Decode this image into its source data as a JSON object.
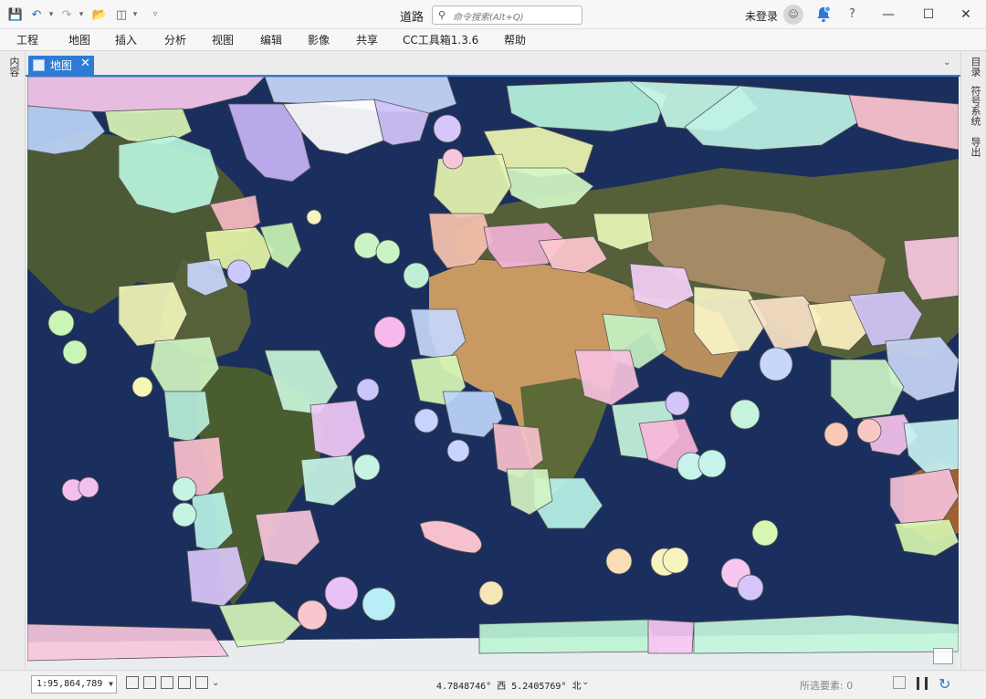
{
  "titlebar": {
    "doc_title": "道路",
    "search_placeholder": "命令搜索(Alt+Q)",
    "login_label": "未登录",
    "help_label": "?"
  },
  "ribbon": {
    "tabs": [
      "工程",
      "地图",
      "插入",
      "分析",
      "视图",
      "编辑",
      "影像",
      "共享",
      "CC工具箱1.3.6",
      "帮助"
    ]
  },
  "left_pane": {
    "tab_label": "内容"
  },
  "right_pane": {
    "tabs": [
      "目录",
      "符号系统",
      "导出"
    ]
  },
  "map_view": {
    "tab_label": "地图",
    "layer": "world marine ecoregions (multicolor polygons) over satellite imagery"
  },
  "statusbar": {
    "scale": "1:95,864,789",
    "coordinates": "4.7848746° 西 5.2405769° 北",
    "selected_features_label": "所选要素:",
    "selected_features_count": "0"
  },
  "colors": {
    "accent": "#2e7bd6",
    "ocean": "#1b2f5e",
    "land": "#4b5a34",
    "desert": "#c89a62",
    "ice": "#e8ecef"
  }
}
